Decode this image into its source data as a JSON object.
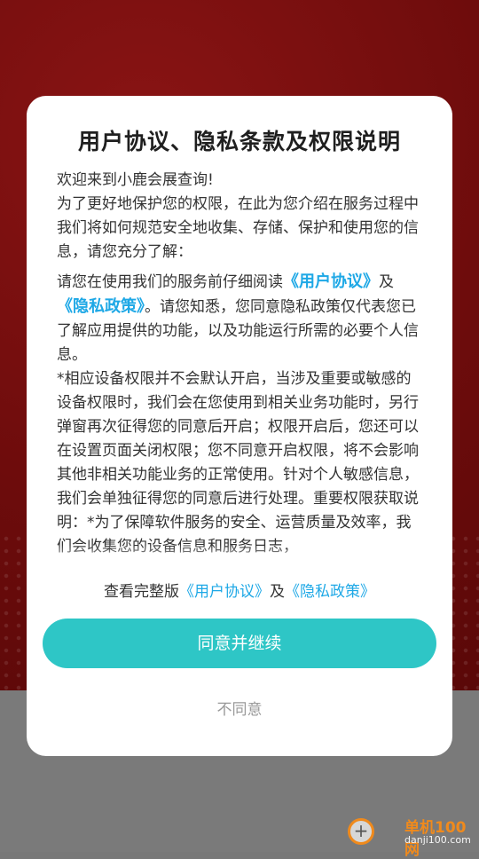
{
  "dialog": {
    "title": "用户协议、隐私条款及权限说明",
    "paragraphs": {
      "p1": "欢迎来到小鹿会展查询!",
      "p2": "为了更好地保护您的权限，在此为您介绍在服务过程中我们将如何规范安全地收集、存储、保护和使用您的信息，请您充分了解：",
      "p3_pre": "请您在使用我们的服务前仔细阅读",
      "p3_link1": "《用户协议》",
      "p3_mid": "及",
      "p3_link2": "《隐私政策》",
      "p3_post": "。请您知悉，您同意隐私政策仅代表您已了解应用提供的功能，以及功能运行所需的必要个人信息。",
      "p4": "*相应设备权限并不会默认开启，当涉及重要或敏感的设备权限时，我们会在您使用到相关业务功能时，另行弹窗再次征得您的同意后开启；权限开启后，您还可以在设置页面关闭权限；您不同意开启权限，将不会影响其他非相关功能业务的正常使用。针对个人敏感信息，我们会单独征得您的同意后进行处理。重要权限获取说明：*为了保障软件服务的安全、运营质量及效率，我们会收集您的设备信息和服务日志，"
    },
    "full_version": {
      "pre": "查看完整版",
      "link1": "《用户协议》",
      "mid": "及",
      "link2": "《隐私政策》"
    },
    "agree_label": "同意并继续",
    "disagree_label": "不同意"
  },
  "watermark": {
    "cn": "单机100网",
    "en": "danji100.com"
  },
  "colors": {
    "accent": "#2ec6c6",
    "link": "#1ea8e6",
    "background_red": "#6e0c0c",
    "watermark_orange": "#f08a1c"
  }
}
